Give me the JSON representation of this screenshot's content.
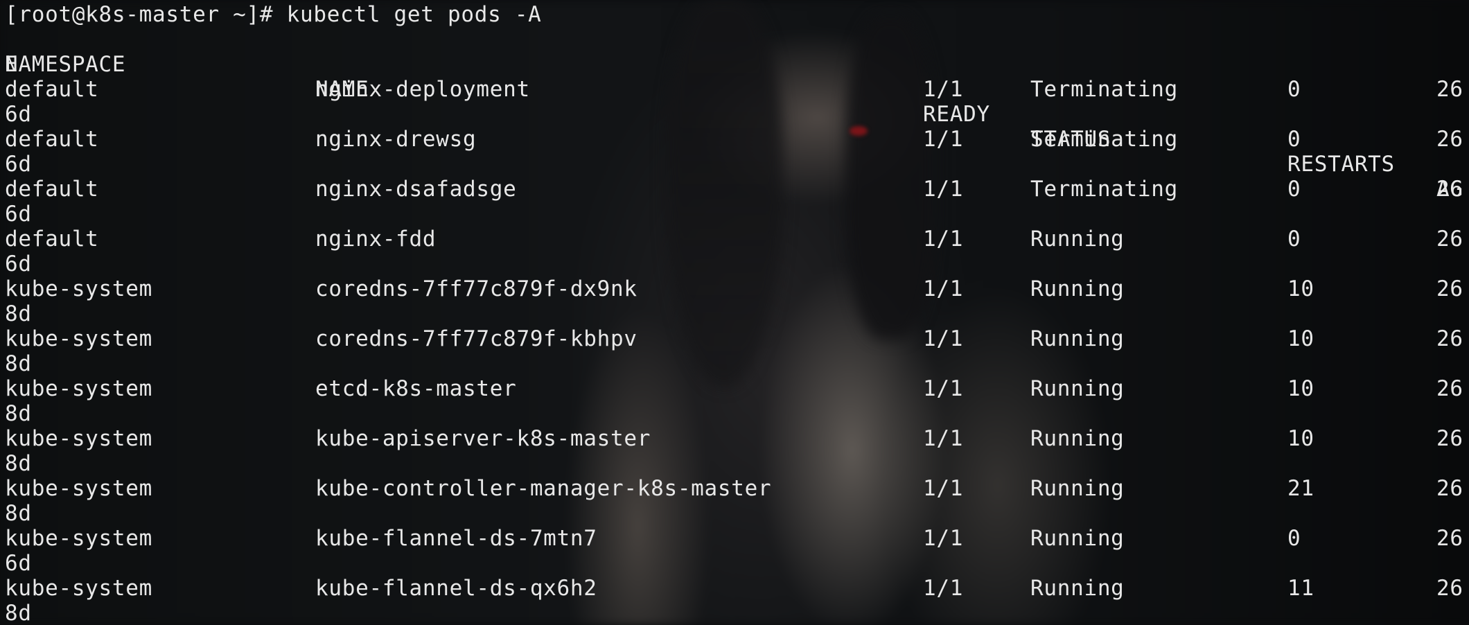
{
  "prompt": "[root@k8s-master ~]# kubectl get pods -A",
  "headers": {
    "namespace": "NAMESPACE",
    "name": "NAME",
    "ready": "READY",
    "status": "STATUS",
    "restarts": "RESTARTS",
    "age": "AG",
    "age_wrap": "E"
  },
  "rows": [
    {
      "namespace": "default",
      "name": "nginx-deployment",
      "ready": "1/1",
      "status": "Terminating",
      "restarts": "0",
      "age": "26",
      "age_wrap": "6d"
    },
    {
      "namespace": "default",
      "name": "nginx-drewsg",
      "ready": "1/1",
      "status": "Terminating",
      "restarts": "0",
      "age": "26",
      "age_wrap": "6d"
    },
    {
      "namespace": "default",
      "name": "nginx-dsafadsge",
      "ready": "1/1",
      "status": "Terminating",
      "restarts": "0",
      "age": "26",
      "age_wrap": "6d"
    },
    {
      "namespace": "default",
      "name": "nginx-fdd",
      "ready": "1/1",
      "status": "Running",
      "restarts": "0",
      "age": "26",
      "age_wrap": "6d"
    },
    {
      "namespace": "kube-system",
      "name": "coredns-7ff77c879f-dx9nk",
      "ready": "1/1",
      "status": "Running",
      "restarts": "10",
      "age": "26",
      "age_wrap": "8d"
    },
    {
      "namespace": "kube-system",
      "name": "coredns-7ff77c879f-kbhpv",
      "ready": "1/1",
      "status": "Running",
      "restarts": "10",
      "age": "26",
      "age_wrap": "8d"
    },
    {
      "namespace": "kube-system",
      "name": "etcd-k8s-master",
      "ready": "1/1",
      "status": "Running",
      "restarts": "10",
      "age": "26",
      "age_wrap": "8d"
    },
    {
      "namespace": "kube-system",
      "name": "kube-apiserver-k8s-master",
      "ready": "1/1",
      "status": "Running",
      "restarts": "10",
      "age": "26",
      "age_wrap": "8d"
    },
    {
      "namespace": "kube-system",
      "name": "kube-controller-manager-k8s-master",
      "ready": "1/1",
      "status": "Running",
      "restarts": "21",
      "age": "26",
      "age_wrap": "8d"
    },
    {
      "namespace": "kube-system",
      "name": "kube-flannel-ds-7mtn7",
      "ready": "1/1",
      "status": "Running",
      "restarts": "0",
      "age": "26",
      "age_wrap": "6d"
    },
    {
      "namespace": "kube-system",
      "name": "kube-flannel-ds-qx6h2",
      "ready": "1/1",
      "status": "Running",
      "restarts": "11",
      "age": "26",
      "age_wrap": "8d"
    }
  ]
}
